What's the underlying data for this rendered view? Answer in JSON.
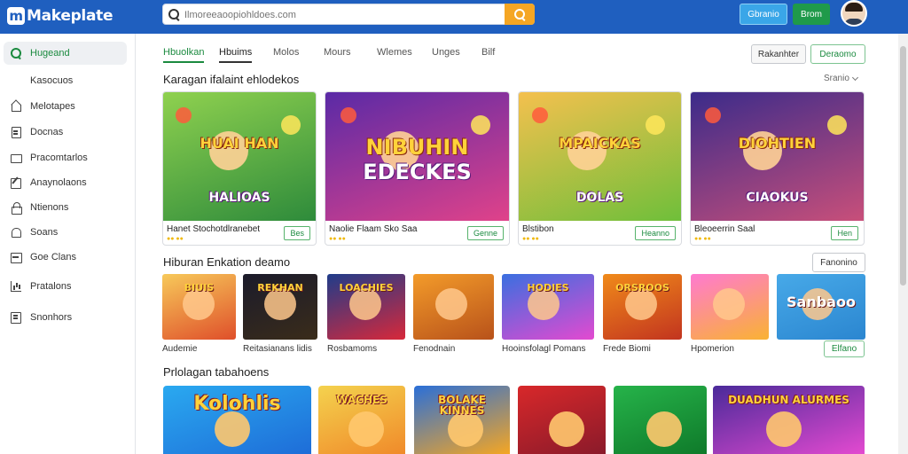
{
  "app": {
    "logo_text": "Makeplate",
    "search_placeholder": "Ilmoreeaoopiohldoes.com",
    "btn_blue": "Gbranio",
    "btn_green": "Brom"
  },
  "sidebar": {
    "items": [
      {
        "label": "Hugeand",
        "icon": "search-icon",
        "active": true
      },
      {
        "label": "Kasocuos",
        "icon": "",
        "active": false
      },
      {
        "label": "Melotapes",
        "icon": "home-icon",
        "active": false
      },
      {
        "label": "Docnas",
        "icon": "document-icon",
        "active": false
      },
      {
        "label": "Pracomtarlos",
        "icon": "folder-icon",
        "active": false
      },
      {
        "label": "Anaynolaons",
        "icon": "edit-icon",
        "active": false
      },
      {
        "label": "Ntienons",
        "icon": "lock-icon",
        "active": false
      },
      {
        "label": "Soans",
        "icon": "bell-icon",
        "active": false
      },
      {
        "label": "Goe Clans",
        "icon": "box-icon",
        "active": false
      },
      {
        "label": "Pratalons",
        "icon": "chart-icon",
        "active": false
      },
      {
        "label": "Snonhors",
        "icon": "list-icon",
        "active": false
      }
    ]
  },
  "tabs": [
    {
      "label": "Hbuolkan",
      "state": "active"
    },
    {
      "label": "Hbuims",
      "state": "underlined"
    },
    {
      "label": "Molos",
      "state": ""
    },
    {
      "label": "Mours",
      "state": ""
    },
    {
      "label": "Wlemes",
      "state": ""
    },
    {
      "label": "Unges",
      "state": ""
    },
    {
      "label": "Bilf",
      "state": ""
    }
  ],
  "header_buttons": {
    "primary": "Rakanhter",
    "secondary": "Deraomo"
  },
  "section1": {
    "title": "Karagan ifalaint ehlodekos",
    "sort_label": "Sranio",
    "cards": [
      {
        "title": "Hanet Stochotdlranebet",
        "button": "Bes",
        "art_text": "HUAI HAN",
        "art_subtitle": "HALIOAS",
        "bg": [
          "#8fd14f",
          "#2e8b3b"
        ]
      },
      {
        "title": "Naolie Flaam Sko Saa",
        "button": "Genne",
        "art_text": "NIBUHIN",
        "art_subtitle": "EDECKES",
        "bg": [
          "#5a2aa6",
          "#e0428a"
        ]
      },
      {
        "title": "Blstibon",
        "button": "Heanno",
        "art_text": "MPAICKAS",
        "art_subtitle": "DOLAS",
        "bg": [
          "#f4c04e",
          "#6fbf3a"
        ]
      },
      {
        "title": "Bleoeerrin Saal",
        "button": "Hen",
        "art_text": "DIOHTIEN",
        "art_subtitle": "CIAOKUS",
        "bg": [
          "#3b2b8a",
          "#c84f7a"
        ]
      }
    ]
  },
  "section2": {
    "title": "Hiburan Enkation deamo",
    "button": "Fanonino",
    "tiles": [
      {
        "label": "Audemie",
        "art": "BIUIS",
        "bg": [
          "#f7c95a",
          "#df4f2a"
        ]
      },
      {
        "label": "Reitasianans lidis",
        "art": "REKHAN",
        "bg": [
          "#1b1b2b",
          "#3a2c1a"
        ]
      },
      {
        "label": "Rosbamoms",
        "art": "LOACHIES",
        "bg": [
          "#1f3c8a",
          "#d8283a"
        ]
      },
      {
        "label": "Fenodnain",
        "art": "",
        "bg": [
          "#f39b2a",
          "#b8521a"
        ]
      },
      {
        "label": "Hooinsfolagl Pomans",
        "art": "HODIES",
        "bg": [
          "#3a6fe0",
          "#e34ad0"
        ]
      },
      {
        "label": "Frede Biomi",
        "art": "ORSROOS",
        "bg": [
          "#f08a1a",
          "#c2341f"
        ]
      },
      {
        "label": "Hpomerion",
        "art": "",
        "bg": [
          "#ff7ad0",
          "#f9b233"
        ]
      },
      {
        "label": "",
        "art": "Sanbaoo",
        "bg": [
          "#47a9e8",
          "#2b86d0"
        ]
      }
    ],
    "tile_button": "Elfano"
  },
  "section3": {
    "title": "Prlolagan tabahoens",
    "tiles": [
      {
        "art": "Kolohlis",
        "bg": [
          "#2aa9f0",
          "#1e6dd8"
        ]
      },
      {
        "art": "WACHES",
        "bg": [
          "#f4d24e",
          "#f08a2a"
        ]
      },
      {
        "art": "BOLAKE KINNES",
        "bg": [
          "#2a6fd8",
          "#f5a623"
        ]
      },
      {
        "art": "",
        "bg": [
          "#d8282a",
          "#8a1a2a"
        ]
      },
      {
        "art": "",
        "bg": [
          "#26b34a",
          "#0f7a2a"
        ]
      },
      {
        "art": "DUADHUN ALURMES",
        "bg": [
          "#4a2a9a",
          "#e34ad0"
        ]
      }
    ]
  }
}
